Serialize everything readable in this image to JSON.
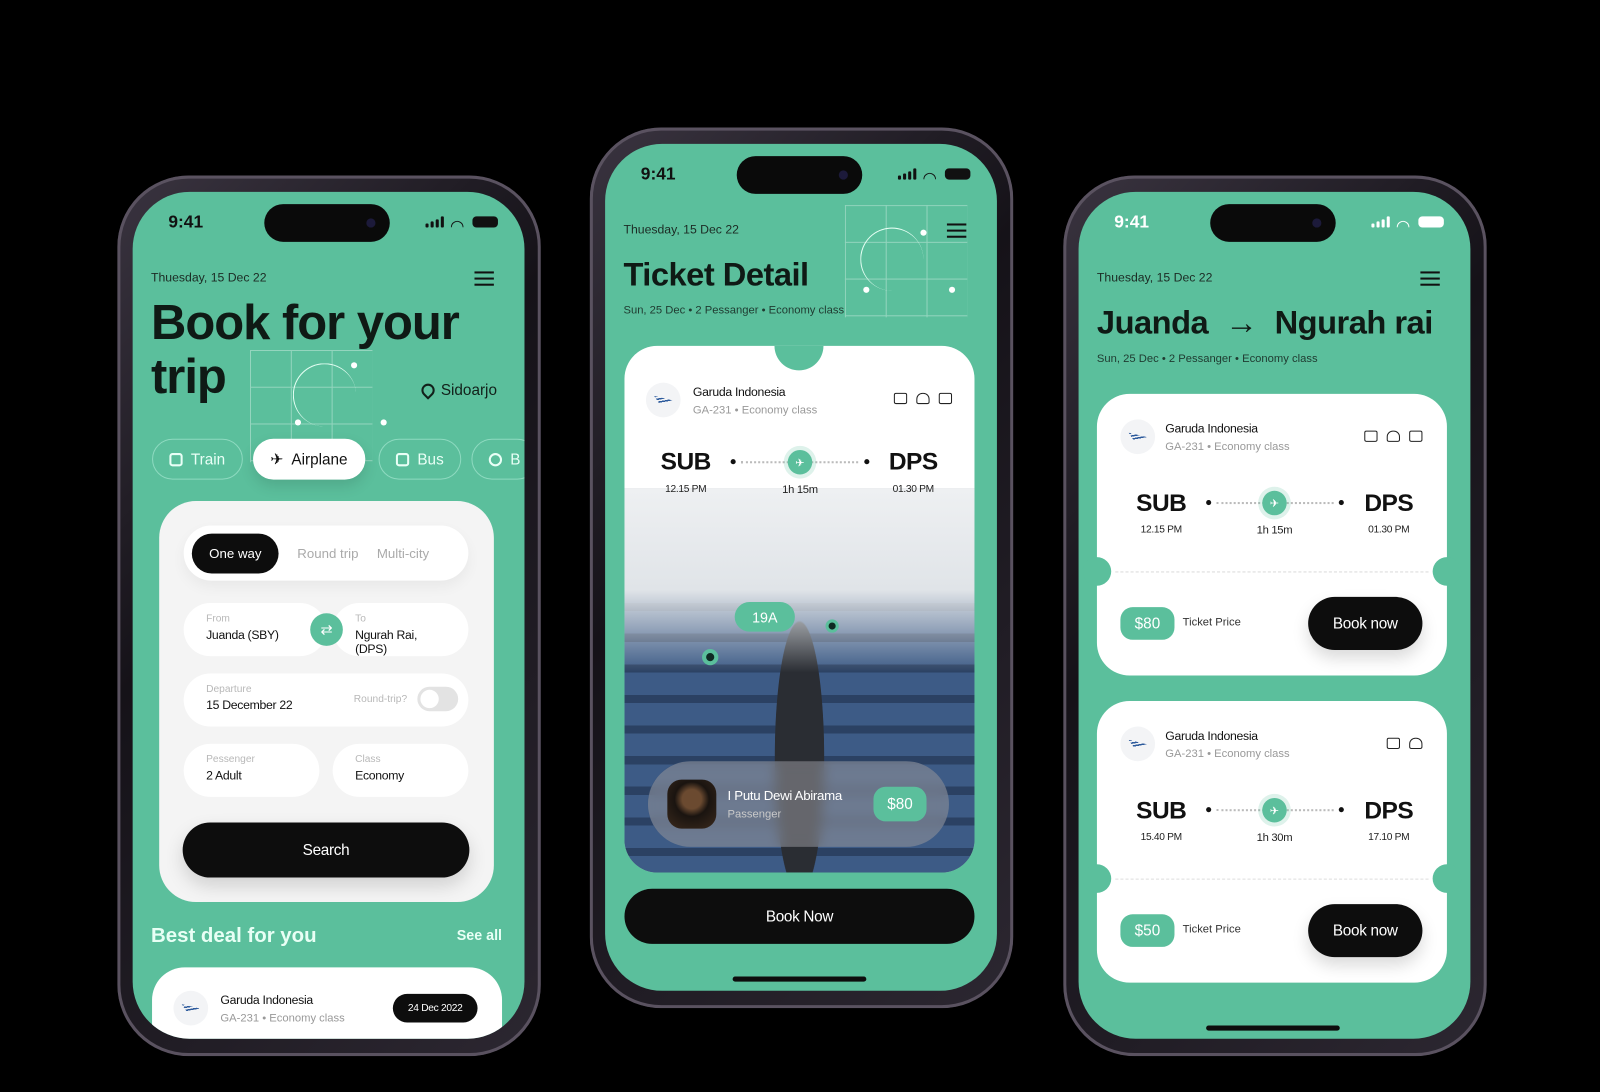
{
  "status_time": "9:41",
  "date_label": "Thuesday, 15 Dec 22",
  "colors": {
    "accent": "#5bbf9c",
    "dark": "#0d0d0d",
    "card": "#ffffff"
  },
  "booking": {
    "title_line1": "Book for your",
    "title_line2": "trip",
    "location": "Sidoarjo",
    "transport_tabs": [
      {
        "label": "Train",
        "icon": "train-icon"
      },
      {
        "label": "Airplane",
        "icon": "airplane-icon",
        "active": true
      },
      {
        "label": "Bus",
        "icon": "bus-icon"
      },
      {
        "label": "B",
        "icon": "boat-icon"
      }
    ],
    "trip_types": [
      "One way",
      "Round trip",
      "Multi-city"
    ],
    "from": {
      "label": "From",
      "value": "Juanda (SBY)"
    },
    "to": {
      "label": "To",
      "value": "Ngurah Rai, (DPS)"
    },
    "departure": {
      "label": "Departure",
      "value": "15 December 22"
    },
    "round_trip": {
      "label": "Round-trip?",
      "on": false
    },
    "passenger": {
      "label": "Pessenger",
      "value": "2 Adult"
    },
    "class": {
      "label": "Class",
      "value": "Economy"
    },
    "search_label": "Search",
    "best_deal": "Best deal for you",
    "see_all": "See all",
    "deal": {
      "airline": "Garuda Indonesia",
      "flight": "GA-231",
      "class": "Economy class",
      "date": "24 Dec 2022"
    }
  },
  "ticket": {
    "title": "Ticket Detail",
    "meta": [
      "Sun, 25 Dec",
      "2 Pessanger",
      "Economy class"
    ],
    "airline": "Garuda Indonesia",
    "flight": "GA-231",
    "class": "Economy class",
    "from_code": "SUB",
    "from_time": "12.15 PM",
    "duration": "1h 15m",
    "to_code": "DPS",
    "to_time": "01.30 PM",
    "seat": "19A",
    "passenger_name": "I Putu Dewi Abirama",
    "passenger_role": "Passenger",
    "price": "$80",
    "book_label": "Book Now"
  },
  "results": {
    "from": "Juanda",
    "arrow": "→",
    "to": "Ngurah rai",
    "meta": [
      "Sun, 25 Dec",
      "2 Pessanger",
      "Economy class"
    ],
    "price_label": "Ticket Price",
    "book_label": "Book now",
    "flights": [
      {
        "airline": "Garuda Indonesia",
        "flight": "GA-231",
        "class": "Economy class",
        "from_code": "SUB",
        "from_time": "12.15 PM",
        "duration": "1h 15m",
        "to_code": "DPS",
        "to_time": "01.30 PM",
        "price": "$80",
        "amenities": [
          "luggage-icon",
          "meal-icon",
          "entertainment-icon"
        ]
      },
      {
        "airline": "Garuda Indonesia",
        "flight": "GA-231",
        "class": "Economy class",
        "from_code": "SUB",
        "from_time": "15.40 PM",
        "duration": "1h 30m",
        "to_code": "DPS",
        "to_time": "17.10 PM",
        "price": "$50",
        "amenities": [
          "luggage-icon",
          "meal-icon"
        ]
      }
    ]
  }
}
